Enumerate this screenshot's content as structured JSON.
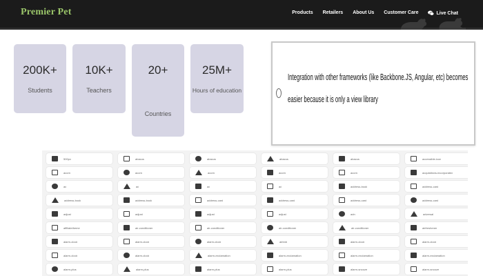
{
  "brand": {
    "name": "Premier Pet"
  },
  "nav": {
    "items": [
      "Products",
      "Retailers",
      "About Us",
      "Customer Care"
    ],
    "chat_label": "Live Chat"
  },
  "stats": [
    {
      "value": "200K+",
      "label": "Students"
    },
    {
      "value": "10K+",
      "label": "Teachers"
    },
    {
      "value": "20+",
      "label": "Countries"
    },
    {
      "value": "25M+",
      "label": "Hours of education"
    }
  ],
  "quote": {
    "text": "Integration with other frameworks (like Backbone.JS, Angular, etc) becomes easier because it is only a view library"
  },
  "icon_grid": {
    "rows": [
      [
        "500px",
        "abacus",
        "abacus",
        "abacus",
        "abacus",
        "accessible-icon"
      ],
      [
        "acorn",
        "acorn",
        "acorn",
        "acorn",
        "acorn",
        "acquisitions-incorporated"
      ],
      [
        "ad",
        "ad",
        "ad",
        "ad",
        "address-book",
        "address-card"
      ],
      [
        "address-book",
        "address-book",
        "address-card",
        "address-card",
        "address-card",
        "address-card"
      ],
      [
        "adjust",
        "adjust",
        "adjust",
        "adjust",
        "adn",
        "adversal"
      ],
      [
        "affiliatetheme",
        "air-conditioner",
        "air-conditioner",
        "air-conditioner",
        "air-conditioner",
        "airfreshener"
      ],
      [
        "alarm-clock",
        "alarm-clock",
        "alarm-clock",
        "airbnb",
        "alarm-clock",
        "alarm-clock"
      ],
      [
        "alarm-clock",
        "alarm-clock",
        "alarm-exclamation",
        "alarm-exclamation",
        "alarm-exclamation",
        "alarm-exclamation"
      ],
      [
        "alarm-plus",
        "alarm-plus",
        "alarm-plus",
        "alarm-plus",
        "alarm-snooze",
        "alarm-snooze"
      ]
    ]
  },
  "colors": {
    "brand_green": "#9bc66a",
    "nav_bg": "#1b1b1b",
    "card_bg": "#d6d5e4"
  }
}
